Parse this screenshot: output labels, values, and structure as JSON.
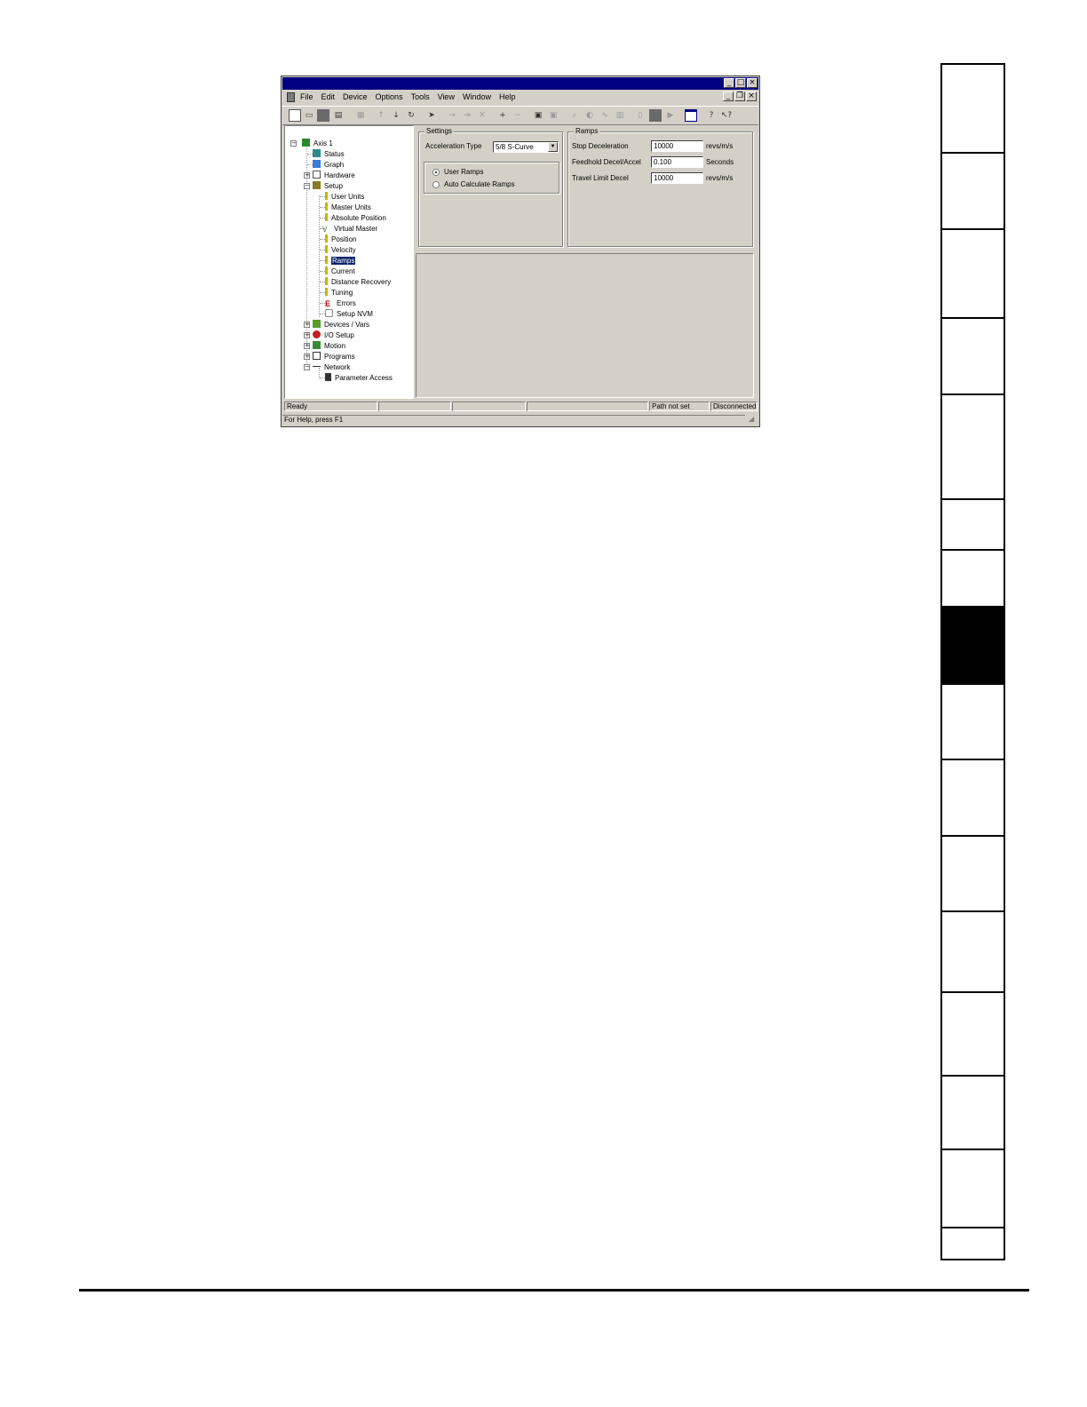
{
  "window": {
    "menu": [
      "File",
      "Edit",
      "Device",
      "Options",
      "Tools",
      "View",
      "Window",
      "Help"
    ]
  },
  "toolbar_icons": [
    "new-icon",
    "open-icon",
    "save-icon",
    "print-icon",
    "properties-icon",
    "upload-icon",
    "download-icon",
    "compare-icon",
    "cursor-icon",
    "step-icon",
    "step-over-icon",
    "stop-icon",
    "add-icon",
    "remove-icon",
    "cut-icon",
    "copy-icon",
    "zoom-icon",
    "watch-icon",
    "scope-icon",
    "trace-icon",
    "drive-icon",
    "stop-drive-icon",
    "run-icon",
    "window-icon",
    "help-icon",
    "context-help-icon"
  ],
  "tree": {
    "root": "Axis 1",
    "items": [
      "Status",
      "Graph",
      "Hardware",
      "Setup",
      "User Units",
      "Master Units",
      "Absolute Position",
      "Virtual Master",
      "Position",
      "Velocity",
      "Ramps",
      "Current",
      "Distance Recovery",
      "Tuning",
      "Errors",
      "Setup NVM",
      "Devices / Vars",
      "I/O Setup",
      "Motion",
      "Programs",
      "Network",
      "Parameter Access"
    ],
    "selected": "Ramps"
  },
  "settings": {
    "legend": "Settings",
    "accel_type_label": "Acceleration Type",
    "accel_type_value": "5/8 S-Curve",
    "radio_user": "User Ramps",
    "radio_auto": "Auto Calculate Ramps",
    "selected_radio": "User Ramps"
  },
  "ramps": {
    "legend": "Ramps",
    "stop_decel_label": "Stop Deceleration",
    "stop_decel_value": "10000",
    "stop_decel_unit": "revs/m/s",
    "feedhold_label": "Feedhold Decel/Accel",
    "feedhold_value": "0.100",
    "feedhold_unit": "Seconds",
    "travel_label": "Travel Limit Decel",
    "travel_value": "10000",
    "travel_unit": "revs/m/s"
  },
  "status": {
    "ready": "Ready",
    "path": "Path not set",
    "connection": "Disconnected",
    "help": "For Help, press F1"
  },
  "side_tabs": {
    "count": 16,
    "active_index": 7
  }
}
